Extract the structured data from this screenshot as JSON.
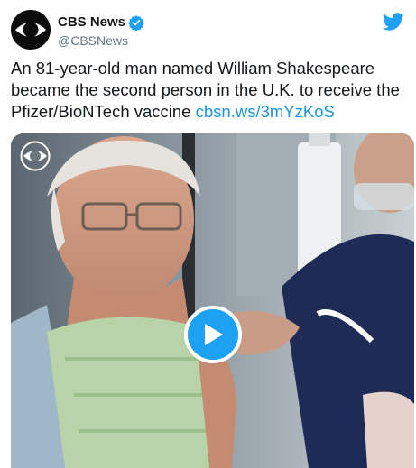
{
  "account": {
    "display_name": "CBS News",
    "handle": "@CBSNews",
    "verified": true
  },
  "tweet": {
    "text": "An 81-year-old man named William Shakespeare became the second person in the U.K. to receive the Pfizer/BioNTech vaccine ",
    "link": "cbsn.ws/3mYzKoS"
  },
  "icons": {
    "avatar": "cbs-eye-logo",
    "verified": "verified-badge-icon",
    "brand": "twitter-bird-icon",
    "watermark": "cbs-eye-logo",
    "play": "play-icon"
  },
  "colors": {
    "link": "#1b95e0",
    "twitter_blue": "#1da1f2",
    "handle_gray": "#657786"
  }
}
